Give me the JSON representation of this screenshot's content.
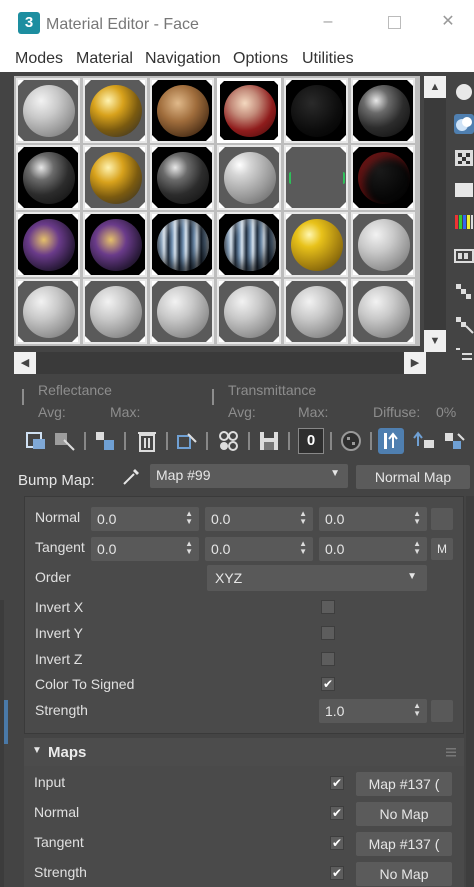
{
  "window": {
    "app_icon": "3",
    "title": "Material Editor - Face",
    "minimize": "–",
    "close": "✕"
  },
  "menu": [
    "Modes",
    "Material",
    "Navigation",
    "Options",
    "Utilities"
  ],
  "samples": [
    [
      "plain-gray",
      "gold-granite",
      "bronze-leaf",
      "red-face",
      "black-dark",
      "black-granite"
    ],
    [
      "black-granite",
      "gold-granite",
      "black-granite",
      "glossy-gray",
      "empty-green",
      "black-red-glow"
    ],
    [
      "purple-gold-face",
      "purple-gold-face",
      "blue-stripes",
      "blue-stripes",
      "gold-glossy",
      "plain-gray"
    ],
    [
      "plain-gray",
      "plain-gray",
      "plain-gray",
      "plain-gray",
      "plain-gray",
      "plain-gray"
    ]
  ],
  "reflectance": {
    "reflectance_label": "Reflectance",
    "transmittance_label": "Transmittance",
    "avg_label": "Avg:",
    "max_label": "Max:",
    "avg2_label": "Avg:",
    "max2_label": "Max:",
    "diffuse_label": "Diffuse:",
    "diffuse_value": "0%"
  },
  "toolbar_icons": [
    "get-material-icon",
    "put-to-scene-icon",
    "assign-material-icon",
    "delete-icon",
    "make-copy-icon",
    "make-unique-icon",
    "put-to-library-icon",
    "material-id-icon",
    "show-map-icon",
    "show-end-result-icon",
    "go-to-parent-icon",
    "go-forward-icon"
  ],
  "material_id": "0",
  "bump": {
    "label": "Bump Map:",
    "map_value": "Map #99",
    "type_button": "Normal Map"
  },
  "params": {
    "normal_label": "Normal",
    "tangent_label": "Tangent",
    "normal_values": [
      "0.0",
      "0.0",
      "0.0"
    ],
    "tangent_values": [
      "0.0",
      "0.0",
      "0.0"
    ],
    "tangent_m": "M",
    "order_label": "Order",
    "order_value": "XYZ",
    "invert_x": "Invert X",
    "invert_y": "Invert Y",
    "invert_z": "Invert Z",
    "color_to_signed": "Color To Signed",
    "strength_label": "Strength",
    "strength_value": "1.0",
    "checks": {
      "invert_x": false,
      "invert_y": false,
      "invert_z": false,
      "color_to_signed": true
    }
  },
  "maps": {
    "title": "Maps",
    "rows": [
      {
        "label": "Input",
        "checked": true,
        "map": "Map #137 ("
      },
      {
        "label": "Normal",
        "checked": true,
        "map": "No Map"
      },
      {
        "label": "Tangent",
        "checked": true,
        "map": "Map #137 ("
      },
      {
        "label": "Strength",
        "checked": true,
        "map": "No Map"
      }
    ]
  },
  "check_glyph": "✔",
  "colors": {
    "accent_blue": "#5d8fc4",
    "panel": "#4a4a4a",
    "background": "#444444"
  }
}
